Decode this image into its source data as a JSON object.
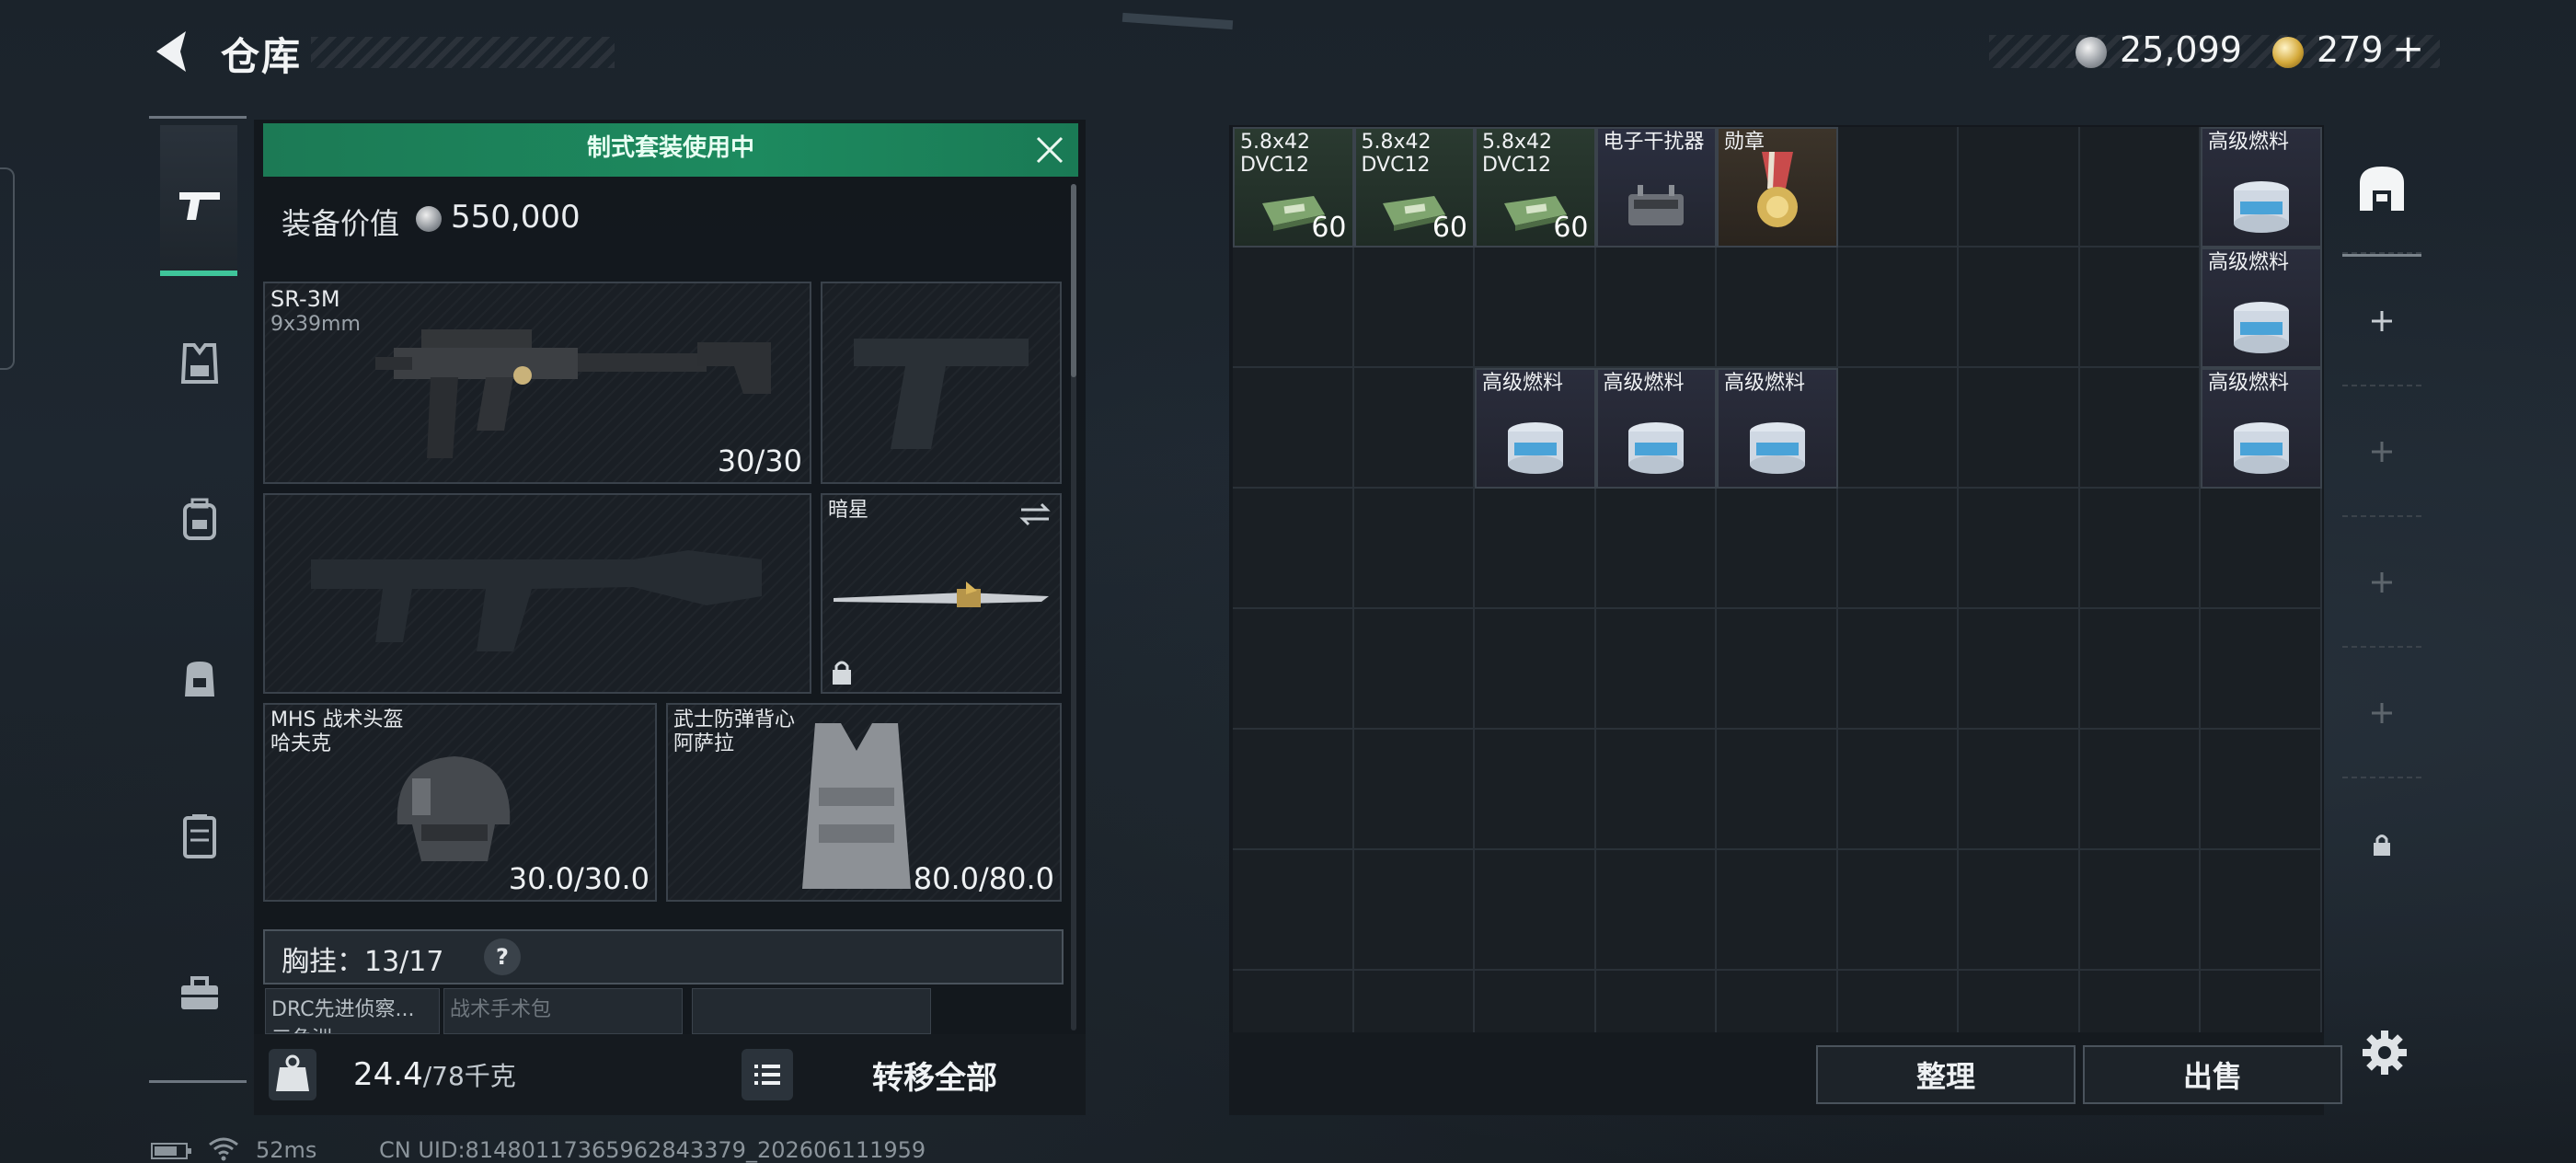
{
  "header": {
    "title": "仓库"
  },
  "currency": {
    "silver": "25,099",
    "gold": "279",
    "gold_add": "+"
  },
  "loadout": {
    "banner": "制式套装使用中",
    "value_label": "装备价值",
    "value": "550,000",
    "primary": {
      "name": "SR-3M",
      "caliber": "9x39mm",
      "ammo": "30/30"
    },
    "melee": {
      "name": "暗星"
    },
    "helmet": {
      "name": "MHS 战术头盔",
      "maker": "哈夫克",
      "durability": "30.0/30.0"
    },
    "vest": {
      "name": "武士防弹背心",
      "maker": "阿萨拉",
      "durability": "80.0/80.0"
    },
    "chest_label": "胸挂：",
    "chest_capacity": "13/17",
    "chest_help": "?",
    "pouches": [
      {
        "name": "DRC先进侦察...",
        "sub": "三角洲"
      },
      {
        "name": "战术手术包",
        "sub": ""
      }
    ],
    "weight": "24.4",
    "weight_max": "/78千克",
    "transfer_all": "转移全部"
  },
  "storage": {
    "items": [
      {
        "name": "5.8x42 DVC12",
        "count": "60",
        "type": "ammo"
      },
      {
        "name": "5.8x42 DVC12",
        "count": "60",
        "type": "ammo"
      },
      {
        "name": "5.8x42 DVC12",
        "count": "60",
        "type": "ammo"
      },
      {
        "name": "电子干扰器",
        "count": "",
        "type": "elec"
      },
      {
        "name": "勋章",
        "count": "",
        "type": "medal"
      },
      {
        "name": "高级燃料",
        "count": "",
        "type": "fuel"
      },
      {
        "name": "高级燃料",
        "count": "",
        "type": "fuel"
      },
      {
        "name": "高级燃料",
        "count": "",
        "type": "fuel"
      },
      {
        "name": "高级燃料",
        "count": "",
        "type": "fuel"
      },
      {
        "name": "高级燃料",
        "count": "",
        "type": "fuel"
      },
      {
        "name": "高级燃料",
        "count": "",
        "type": "fuel"
      }
    ],
    "sort_label": "整理",
    "sell_label": "出售"
  },
  "status_bar": {
    "ping": "52ms",
    "uid": "CN UID:8148011736596284337​9_202606111959"
  },
  "colors": {
    "accent_green": "#1d8a5f",
    "active_tab": "#3fc59a"
  }
}
